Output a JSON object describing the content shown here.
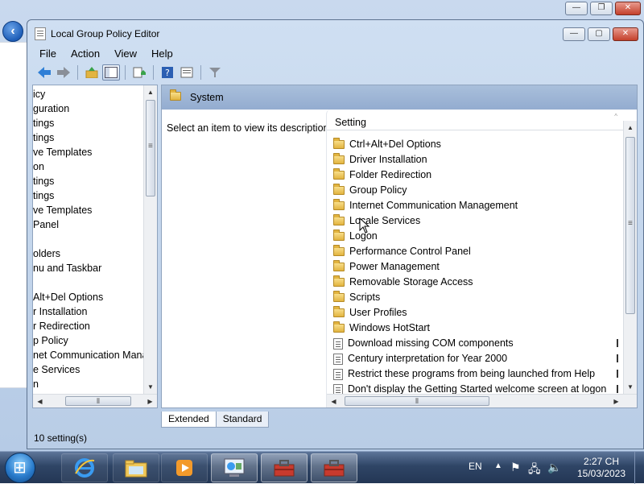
{
  "window": {
    "title": "Local Group Policy Editor"
  },
  "menu": [
    "File",
    "Action",
    "View",
    "Help"
  ],
  "tree": {
    "items": [
      "icy",
      "guration",
      "tings",
      "tings",
      "ve Templates",
      "on",
      "tings",
      "tings",
      "ve Templates",
      "Panel",
      "",
      "olders",
      "nu and Taskbar",
      "",
      "Alt+Del Options",
      "r Installation",
      "r Redirection",
      "p Policy",
      "net Communication Mana",
      "e Services",
      "n"
    ]
  },
  "right": {
    "header_title": "System",
    "description": "Select an item to view its description.",
    "column_setting": "Setting",
    "rows": [
      {
        "label": "Ctrl+Alt+Del Options",
        "type": "folder"
      },
      {
        "label": "Driver Installation",
        "type": "folder"
      },
      {
        "label": "Folder Redirection",
        "type": "folder"
      },
      {
        "label": "Group Policy",
        "type": "folder"
      },
      {
        "label": "Internet Communication Management",
        "type": "folder"
      },
      {
        "label": "Locale Services",
        "type": "folder"
      },
      {
        "label": "Logon",
        "type": "folder"
      },
      {
        "label": "Performance Control Panel",
        "type": "folder"
      },
      {
        "label": "Power Management",
        "type": "folder"
      },
      {
        "label": "Removable Storage Access",
        "type": "folder"
      },
      {
        "label": "Scripts",
        "type": "folder"
      },
      {
        "label": "User Profiles",
        "type": "folder"
      },
      {
        "label": "Windows HotStart",
        "type": "folder"
      },
      {
        "label": "Download missing COM components",
        "type": "setting"
      },
      {
        "label": "Century interpretation for Year 2000",
        "type": "setting"
      },
      {
        "label": "Restrict these programs from being launched from Help",
        "type": "setting"
      },
      {
        "label": "Don't display the Getting Started welcome screen at logon",
        "type": "setting"
      }
    ]
  },
  "tabs": {
    "extended": "Extended",
    "standard": "Standard"
  },
  "status": {
    "text": "10 setting(s)"
  },
  "taskbar": {
    "language": "EN",
    "time": "2:27 CH",
    "date": "15/03/2023"
  }
}
